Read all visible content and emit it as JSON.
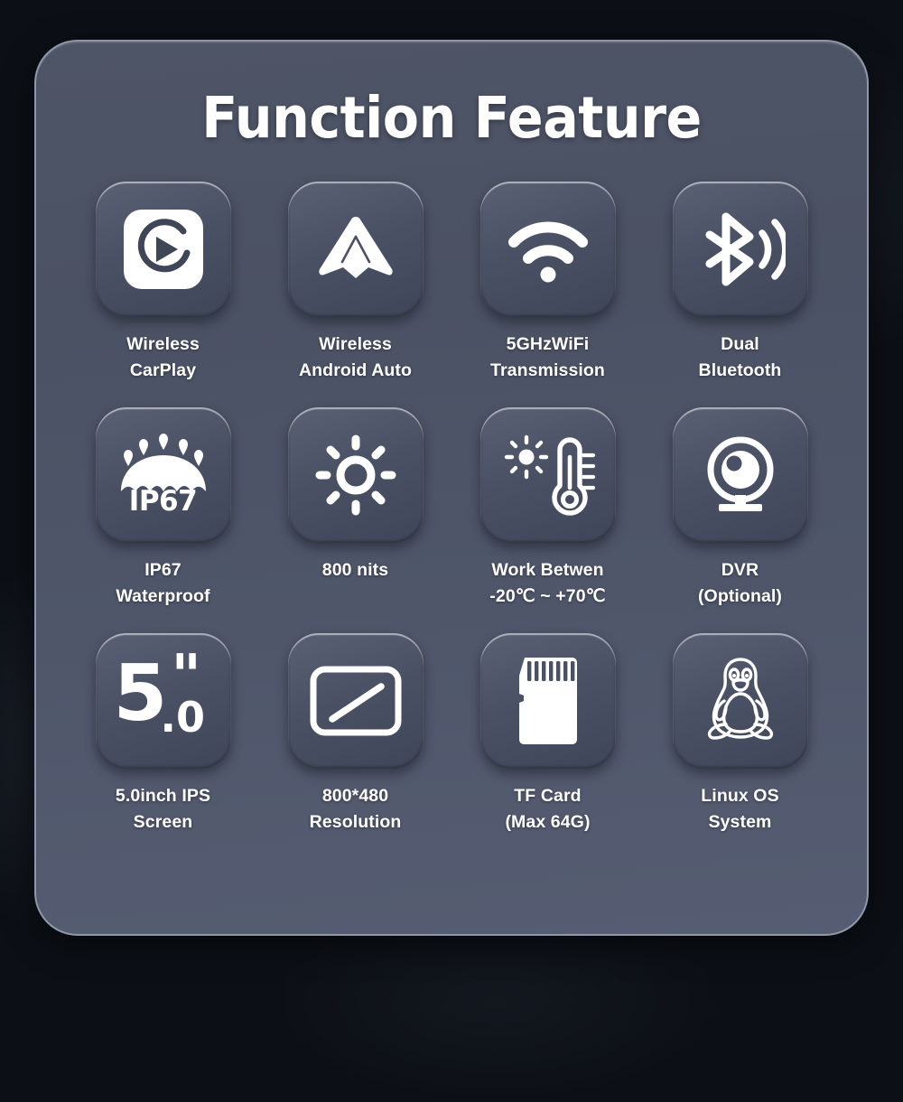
{
  "background": {
    "color": "#0c1016",
    "panel_color_top": "#4e5567",
    "panel_color_bottom": "#565d72",
    "panel_border": "#8f97a8",
    "tile_color_top": "#5a6174",
    "tile_color_bottom": "#3f4658",
    "text_color": "#ffffff"
  },
  "header": {
    "title": "Function Feature"
  },
  "features": [
    {
      "icon": "carplay-icon",
      "caption": "Wireless\nCarPlay",
      "line1": "Wireless",
      "line2": "CarPlay"
    },
    {
      "icon": "android-auto-icon",
      "caption": "Wireless\nAndroid Auto",
      "line1": "Wireless",
      "line2": "Android Auto"
    },
    {
      "icon": "wifi-icon",
      "caption": "5GHzWiFi\nTransmission",
      "line1": "5GHzWiFi",
      "line2": "Transmission"
    },
    {
      "icon": "bluetooth-icon",
      "caption": "Dual\nBluetooth",
      "line1": "Dual",
      "line2": "Bluetooth"
    },
    {
      "icon": "umbrella-waterproof-icon",
      "icon_text": "IP67",
      "caption": "IP67\nWaterproof",
      "line1": "IP67",
      "line2": "Waterproof"
    },
    {
      "icon": "brightness-sun-icon",
      "caption": "800 nits",
      "line1": "800 nits",
      "line2": ""
    },
    {
      "icon": "thermometer-sun-icon",
      "caption": "Work Betwen\n-20℃ ~ +70℃",
      "line1": "Work Betwen",
      "line2": "-20℃ ~ +70℃"
    },
    {
      "icon": "webcam-dvr-icon",
      "caption": "DVR\n(Optional)",
      "line1": "DVR",
      "line2": "(Optional)"
    },
    {
      "icon": "screen-size-text-icon",
      "icon_text_main": "5",
      "icon_text_marks": "\"",
      "icon_text_decimal": ".0",
      "caption": "5.0inch IPS\nScreen",
      "line1": "5.0inch IPS",
      "line2": "Screen"
    },
    {
      "icon": "screen-diagonal-icon",
      "caption": "800*480\nResolution",
      "line1": "800*480",
      "line2": "Resolution"
    },
    {
      "icon": "tf-card-icon",
      "caption": "TF Card\n(Max 64G)",
      "line1": "TF Card",
      "line2": "(Max 64G)"
    },
    {
      "icon": "linux-penguin-icon",
      "caption": "Linux OS\nSystem",
      "line1": "Linux OS",
      "line2": "System"
    }
  ]
}
